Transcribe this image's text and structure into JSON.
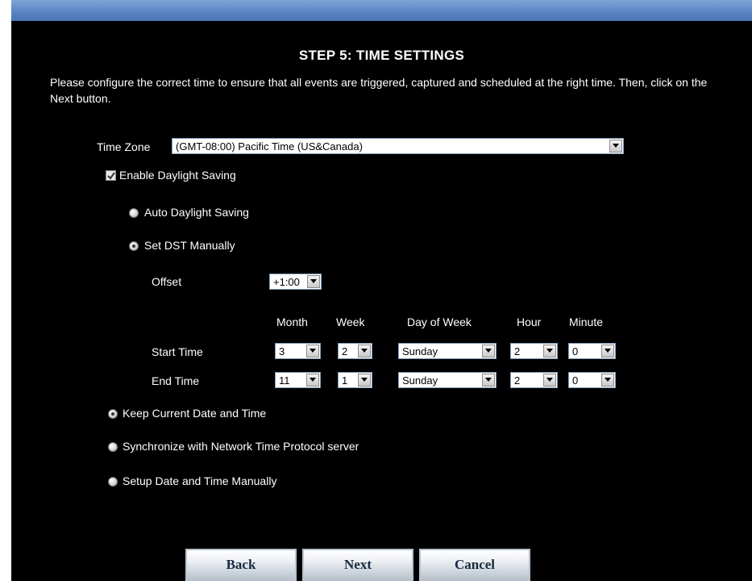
{
  "title": "STEP 5: TIME SETTINGS",
  "description": "Please configure the correct time to ensure that all events are triggered, captured and scheduled at the right time. Then, click on the Next button.",
  "time_zone": {
    "label": "Time Zone",
    "value": "(GMT-08:00) Pacific Time (US&Canada)"
  },
  "daylight_saving": {
    "label": "Enable Daylight Saving",
    "checked": true,
    "auto_label": "Auto Daylight Saving",
    "manual_label": "Set DST Manually",
    "selected": "manual",
    "offset_label": "Offset",
    "offset_value": "+1:00",
    "columns": [
      "Month",
      "Week",
      "Day of Week",
      "Hour",
      "Minute"
    ],
    "start": {
      "label": "Start Time",
      "month": "3",
      "week": "2",
      "day": "Sunday",
      "hour": "2",
      "minute": "0"
    },
    "end": {
      "label": "End Time",
      "month": "11",
      "week": "1",
      "day": "Sunday",
      "hour": "2",
      "minute": "0"
    }
  },
  "time_mode": {
    "selected": "keep",
    "keep_label": "Keep Current Date and Time",
    "ntp_label": "Synchronize with Network Time Protocol server",
    "manual_label": "Setup Date and Time Manually"
  },
  "buttons": {
    "back": "Back",
    "next": "Next",
    "cancel": "Cancel"
  },
  "colors": {
    "background": "#000000",
    "header_bar": "#5b86c2",
    "text": "#ffffff"
  }
}
